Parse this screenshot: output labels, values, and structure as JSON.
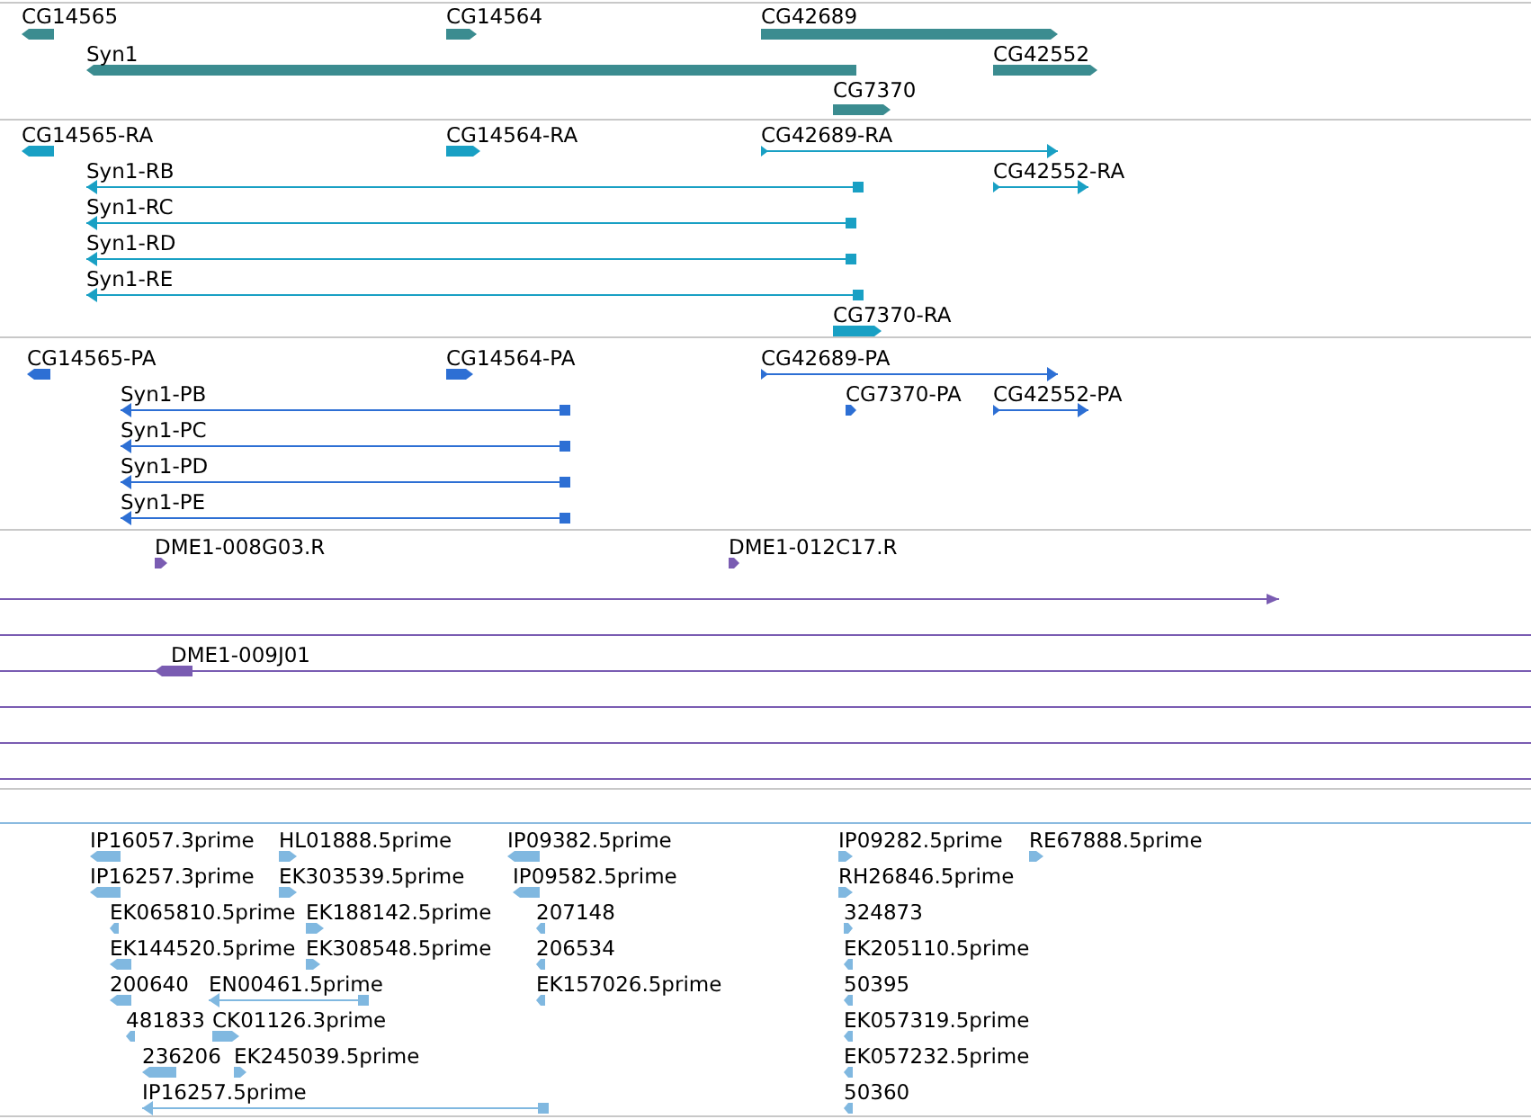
{
  "tracks": [
    {
      "color": "#3b8c90",
      "features": [
        {
          "label": "CG14565",
          "kind": "block",
          "reverse": true
        },
        {
          "label": "CG14564",
          "kind": "block",
          "reverse": false
        },
        {
          "label": "CG42689",
          "kind": "block",
          "reverse": false
        },
        {
          "label": "Syn1",
          "kind": "block",
          "reverse": true
        },
        {
          "label": "CG42552",
          "kind": "block",
          "reverse": false
        },
        {
          "label": "CG7370",
          "kind": "block",
          "reverse": false
        }
      ]
    },
    {
      "color": "#19a0c4",
      "features": [
        {
          "label": "CG14565-RA",
          "kind": "block",
          "reverse": true
        },
        {
          "label": "CG14564-RA",
          "kind": "block",
          "reverse": false
        },
        {
          "label": "CG42689-RA",
          "kind": "spliced",
          "reverse": false
        },
        {
          "label": "Syn1-RB",
          "kind": "spliced",
          "reverse": true
        },
        {
          "label": "CG42552-RA",
          "kind": "spliced",
          "reverse": false
        },
        {
          "label": "Syn1-RC",
          "kind": "spliced",
          "reverse": true
        },
        {
          "label": "Syn1-RD",
          "kind": "spliced",
          "reverse": true
        },
        {
          "label": "Syn1-RE",
          "kind": "spliced",
          "reverse": true
        },
        {
          "label": "CG7370-RA",
          "kind": "block",
          "reverse": false
        }
      ]
    },
    {
      "color": "#2d6fd4",
      "features": [
        {
          "label": "CG14565-PA",
          "kind": "block",
          "reverse": true
        },
        {
          "label": "CG14564-PA",
          "kind": "block",
          "reverse": false
        },
        {
          "label": "CG42689-PA",
          "kind": "spliced",
          "reverse": false
        },
        {
          "label": "Syn1-PB",
          "kind": "spliced",
          "reverse": true
        },
        {
          "label": "CG7370-PA",
          "kind": "block",
          "reverse": false
        },
        {
          "label": "CG42552-PA",
          "kind": "spliced",
          "reverse": false
        },
        {
          "label": "Syn1-PC",
          "kind": "spliced",
          "reverse": true
        },
        {
          "label": "Syn1-PD",
          "kind": "spliced",
          "reverse": true
        },
        {
          "label": "Syn1-PE",
          "kind": "spliced",
          "reverse": true
        }
      ]
    },
    {
      "color": "#7a5cb2",
      "features": [
        {
          "label": "DME1-008G03.R",
          "kind": "block",
          "reverse": false
        },
        {
          "label": "DME1-012C17.R",
          "kind": "block",
          "reverse": false
        },
        {
          "kind": "line",
          "reverse": false
        },
        {
          "kind": "line"
        },
        {
          "kind": "line"
        },
        {
          "label": "DME1-009J01",
          "kind": "block",
          "reverse": true
        },
        {
          "kind": "line"
        },
        {
          "kind": "line"
        },
        {
          "kind": "line"
        }
      ]
    },
    {
      "color": "#80b8e0",
      "features": [
        {
          "label": "IP16057.3prime",
          "kind": "block",
          "reverse": true
        },
        {
          "label": "IP16257.3prime",
          "kind": "block",
          "reverse": true
        },
        {
          "label": "EK065810.5prime",
          "kind": "block",
          "reverse": true
        },
        {
          "label": "EK144520.5prime",
          "kind": "block",
          "reverse": true
        },
        {
          "label": "200640",
          "kind": "block",
          "reverse": true
        },
        {
          "label": "481833",
          "kind": "block",
          "reverse": true
        },
        {
          "label": "236206",
          "kind": "block",
          "reverse": true
        },
        {
          "label": "IP16257.5prime",
          "kind": "spliced",
          "reverse": true
        },
        {
          "label": "HL01888.5prime",
          "kind": "block",
          "reverse": false
        },
        {
          "label": "EK303539.5prime",
          "kind": "block",
          "reverse": false
        },
        {
          "label": "EK188142.5prime",
          "kind": "block",
          "reverse": false
        },
        {
          "label": "EK308548.5prime",
          "kind": "block",
          "reverse": false
        },
        {
          "label": "EN00461.5prime",
          "kind": "spliced",
          "reverse": true
        },
        {
          "label": "CK01126.3prime",
          "kind": "block",
          "reverse": false
        },
        {
          "label": "EK245039.5prime",
          "kind": "block",
          "reverse": false
        },
        {
          "label": "IP09382.5prime",
          "kind": "block",
          "reverse": true
        },
        {
          "label": "IP09582.5prime",
          "kind": "block",
          "reverse": true
        },
        {
          "label": "207148",
          "kind": "block",
          "reverse": true
        },
        {
          "label": "206534",
          "kind": "block",
          "reverse": true
        },
        {
          "label": "EK157026.5prime",
          "kind": "block",
          "reverse": true
        },
        {
          "label": "IP09282.5prime",
          "kind": "block",
          "reverse": false
        },
        {
          "label": "RE67888.5prime",
          "kind": "block",
          "reverse": false
        },
        {
          "label": "RH26846.5prime",
          "kind": "block",
          "reverse": false
        },
        {
          "label": "324873",
          "kind": "block",
          "reverse": false
        },
        {
          "label": "EK205110.5prime",
          "kind": "block",
          "reverse": true
        },
        {
          "label": "50395",
          "kind": "block",
          "reverse": true
        },
        {
          "label": "EK057319.5prime",
          "kind": "block",
          "reverse": true
        },
        {
          "label": "EK057232.5prime",
          "kind": "block",
          "reverse": true
        },
        {
          "label": "50360",
          "kind": "block",
          "reverse": true
        }
      ]
    }
  ]
}
